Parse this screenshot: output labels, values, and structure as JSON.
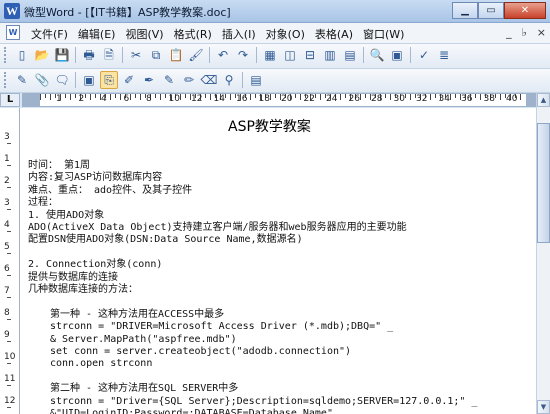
{
  "window": {
    "title": "微型Word - [【IT书籍】ASP教学教案.doc]",
    "controls": {
      "minimize": "▁",
      "maximize": "▭",
      "close": "✕"
    }
  },
  "menubar": {
    "items": [
      "文件(F)",
      "编辑(E)",
      "视图(V)",
      "格式(R)",
      "插入(I)",
      "对象(O)",
      "表格(A)",
      "窗口(W)"
    ],
    "right": [
      "_",
      "♭",
      "×"
    ]
  },
  "toolbar1": {
    "icons": [
      "new-document-icon",
      "open-folder-icon",
      "save-icon",
      "print-icon",
      "print-preview-icon",
      "cut-icon",
      "copy-icon",
      "paste-icon",
      "format-painter-icon",
      "undo-icon",
      "redo-icon",
      "insert-table-icon",
      "insert-columns-icon",
      "insert-rows-icon",
      "delete-rows-icon",
      "delete-columns-icon",
      "find-icon",
      "zoom-icon",
      "spellcheck-icon",
      "word-count-icon"
    ],
    "glyphs": [
      "▯",
      "📂",
      "💾",
      "🖶",
      "🗎",
      "✂",
      "⧉",
      "📋",
      "🖌",
      "↶",
      "↷",
      "▦",
      "◫",
      "⊟",
      "▥",
      "▤",
      "🔍",
      "▣",
      "✓",
      "≣"
    ]
  },
  "toolbar2": {
    "icons": [
      "edit-icon",
      "attach-icon",
      "comment-icon",
      "insert-object-icon",
      "paste-special-icon",
      "highlight-icon",
      "bookmark-icon",
      "highlight-pen-icon",
      "pen-icon",
      "erase-icon",
      "link-icon",
      "document-map-icon"
    ],
    "glyphs": [
      "✎",
      "📎",
      "🗨",
      "▣",
      "⎘",
      "✐",
      "✒",
      "✎",
      "✏",
      "⌫",
      "⚲",
      "▤"
    ]
  },
  "ruler": {
    "corner": "L",
    "labels": [
      "1",
      "2",
      "4",
      "6",
      "8",
      "10",
      "12",
      "14",
      "16",
      "18",
      "20",
      "22",
      "24",
      "26",
      "28",
      "30",
      "32",
      "34",
      "36",
      "38",
      "40"
    ],
    "vlabels": [
      "3",
      "1",
      "2",
      "3",
      "4",
      "5",
      "6",
      "7",
      "8",
      "9",
      "10",
      "11",
      "12",
      "13"
    ]
  },
  "document": {
    "title": "ASP教学教案",
    "lines": [
      "时间： 第1周",
      "内容:复习ASP访问数据库内容",
      "难点、重点： ado控件、及其子控件",
      "过程：",
      "1.  使用ADO对象",
      "ADO(ActiveX Data Object)支持建立客户端/服务器和web服务器应用的主要功能",
      "配置DSN使用ADO对象(DSN:Data Source Name,数据源名)",
      "",
      "2.  Connection对象(conn)",
      "提供与数据库的连接",
      "几种数据库连接的方法：",
      "",
      "第一种 - 这种方法用在ACCESS中最多",
      "strconn = \"DRIVER=Microsoft Access Driver (*.mdb);DBQ=\" _",
      "& Server.MapPath(\"aspfree.mdb\")",
      "set conn = server.createobject(\"adodb.connection\")",
      "conn.open strconn",
      "",
      "第二种 - 这种方法用在SQL SERVER中多",
      "strconn = \"Driver={SQL Server};Description=sqldemo;SERVER=127.0.0.1;\" _",
      "&\"UID=LoginID;Password=;DATABASE=Database_Name\""
    ]
  },
  "scrollbar": {
    "up": "▲",
    "down": "▼"
  }
}
